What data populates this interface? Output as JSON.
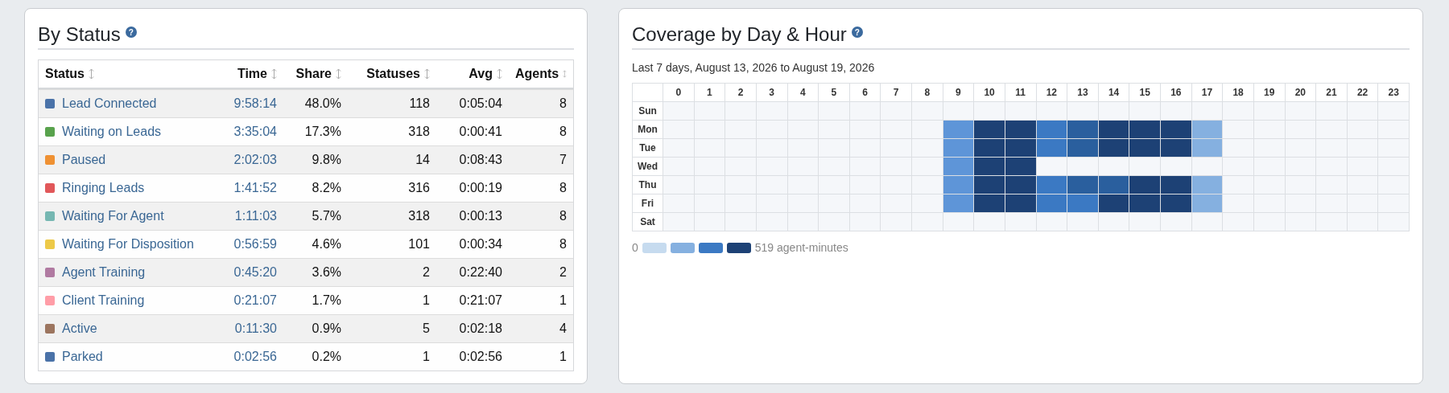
{
  "status_panel": {
    "title": "By Status",
    "help": "?",
    "columns": [
      "Status",
      "Time",
      "Share",
      "Statuses",
      "Avg",
      "Agents"
    ],
    "rows": [
      {
        "status": "Lead Connected",
        "color": "#4a72a8",
        "time": "9:58:14",
        "share": "48.0%",
        "statuses": "118",
        "avg": "0:05:04",
        "agents": "8"
      },
      {
        "status": "Waiting on Leads",
        "color": "#58a24c",
        "time": "3:35:04",
        "share": "17.3%",
        "statuses": "318",
        "avg": "0:00:41",
        "agents": "8"
      },
      {
        "status": "Paused",
        "color": "#ef9133",
        "time": "2:02:03",
        "share": "9.8%",
        "statuses": "14",
        "avg": "0:08:43",
        "agents": "7"
      },
      {
        "status": "Ringing Leads",
        "color": "#e15759",
        "time": "1:41:52",
        "share": "8.2%",
        "statuses": "316",
        "avg": "0:00:19",
        "agents": "8"
      },
      {
        "status": "Waiting For Agent",
        "color": "#76b7b2",
        "time": "1:11:03",
        "share": "5.7%",
        "statuses": "318",
        "avg": "0:00:13",
        "agents": "8"
      },
      {
        "status": "Waiting For Disposition",
        "color": "#edc948",
        "time": "0:56:59",
        "share": "4.6%",
        "statuses": "101",
        "avg": "0:00:34",
        "agents": "8"
      },
      {
        "status": "Agent Training",
        "color": "#b07aa1",
        "time": "0:45:20",
        "share": "3.6%",
        "statuses": "2",
        "avg": "0:22:40",
        "agents": "2"
      },
      {
        "status": "Client Training",
        "color": "#ff9da7",
        "time": "0:21:07",
        "share": "1.7%",
        "statuses": "1",
        "avg": "0:21:07",
        "agents": "1"
      },
      {
        "status": "Active",
        "color": "#9c755f",
        "time": "0:11:30",
        "share": "0.9%",
        "statuses": "5",
        "avg": "0:02:18",
        "agents": "4"
      },
      {
        "status": "Parked",
        "color": "#4a72a8",
        "time": "0:02:56",
        "share": "0.2%",
        "statuses": "1",
        "avg": "0:02:56",
        "agents": "1"
      }
    ]
  },
  "coverage_panel": {
    "title": "Coverage by Day & Hour",
    "help": "?",
    "subtitle": "Last 7 days, August 13, 2026 to August 19, 2026",
    "hours": [
      "0",
      "1",
      "2",
      "3",
      "4",
      "5",
      "6",
      "7",
      "8",
      "9",
      "10",
      "11",
      "12",
      "13",
      "14",
      "15",
      "16",
      "17",
      "18",
      "19",
      "20",
      "21",
      "22",
      "23"
    ],
    "days": [
      {
        "day": "Sun",
        "cells": [
          {
            "color": "#f5f7fa"
          },
          {
            "color": "#f5f7fa"
          },
          {
            "color": "#f5f7fa"
          },
          {
            "color": "#f5f7fa"
          },
          {
            "color": "#f5f7fa"
          },
          {
            "color": "#f5f7fa"
          },
          {
            "color": "#f5f7fa"
          },
          {
            "color": "#f5f7fa"
          },
          {
            "color": "#f5f7fa"
          },
          {
            "color": "#f5f7fa"
          },
          {
            "color": "#f5f7fa"
          },
          {
            "color": "#f5f7fa"
          },
          {
            "color": "#f5f7fa"
          },
          {
            "color": "#f5f7fa"
          },
          {
            "color": "#f5f7fa"
          },
          {
            "color": "#f5f7fa"
          },
          {
            "color": "#f5f7fa"
          },
          {
            "color": "#f5f7fa"
          },
          {
            "color": "#f5f7fa"
          },
          {
            "color": "#f5f7fa"
          },
          {
            "color": "#f5f7fa"
          },
          {
            "color": "#f5f7fa"
          },
          {
            "color": "#f5f7fa"
          },
          {
            "color": "#f5f7fa"
          }
        ]
      },
      {
        "day": "Mon",
        "cells": [
          {
            "color": "#f5f7fa"
          },
          {
            "color": "#f5f7fa"
          },
          {
            "color": "#f5f7fa"
          },
          {
            "color": "#f5f7fa"
          },
          {
            "color": "#f5f7fa"
          },
          {
            "color": "#f5f7fa"
          },
          {
            "color": "#f5f7fa"
          },
          {
            "color": "#f5f7fa"
          },
          {
            "color": "#f5f7fa"
          },
          {
            "color": "#5e95d8"
          },
          {
            "color": "#1d4175"
          },
          {
            "color": "#1d4175"
          },
          {
            "color": "#3b79c3"
          },
          {
            "color": "#2a5f9e"
          },
          {
            "color": "#1d4175"
          },
          {
            "color": "#1d4175"
          },
          {
            "color": "#1d4175"
          },
          {
            "color": "#85b0e0"
          },
          {
            "color": "#f5f7fa"
          },
          {
            "color": "#f5f7fa"
          },
          {
            "color": "#f5f7fa"
          },
          {
            "color": "#f5f7fa"
          },
          {
            "color": "#f5f7fa"
          },
          {
            "color": "#f5f7fa"
          }
        ]
      },
      {
        "day": "Tue",
        "cells": [
          {
            "color": "#f5f7fa"
          },
          {
            "color": "#f5f7fa"
          },
          {
            "color": "#f5f7fa"
          },
          {
            "color": "#f5f7fa"
          },
          {
            "color": "#f5f7fa"
          },
          {
            "color": "#f5f7fa"
          },
          {
            "color": "#f5f7fa"
          },
          {
            "color": "#f5f7fa"
          },
          {
            "color": "#f5f7fa"
          },
          {
            "color": "#5e95d8"
          },
          {
            "color": "#1d4175"
          },
          {
            "color": "#1d4175"
          },
          {
            "color": "#3b79c3"
          },
          {
            "color": "#2a5f9e"
          },
          {
            "color": "#1d4175"
          },
          {
            "color": "#1d4175"
          },
          {
            "color": "#1d4175"
          },
          {
            "color": "#85b0e0"
          },
          {
            "color": "#f5f7fa"
          },
          {
            "color": "#f5f7fa"
          },
          {
            "color": "#f5f7fa"
          },
          {
            "color": "#f5f7fa"
          },
          {
            "color": "#f5f7fa"
          },
          {
            "color": "#f5f7fa"
          }
        ]
      },
      {
        "day": "Wed",
        "cells": [
          {
            "color": "#f5f7fa"
          },
          {
            "color": "#f5f7fa"
          },
          {
            "color": "#f5f7fa"
          },
          {
            "color": "#f5f7fa"
          },
          {
            "color": "#f5f7fa"
          },
          {
            "color": "#f5f7fa"
          },
          {
            "color": "#f5f7fa"
          },
          {
            "color": "#f5f7fa"
          },
          {
            "color": "#f5f7fa"
          },
          {
            "color": "#5e95d8"
          },
          {
            "color": "#1d4175"
          },
          {
            "color": "#1d4175"
          },
          {
            "color": "#f5f7fa"
          },
          {
            "color": "#f5f7fa"
          },
          {
            "color": "#f5f7fa"
          },
          {
            "color": "#f5f7fa"
          },
          {
            "color": "#f5f7fa"
          },
          {
            "color": "#f5f7fa"
          },
          {
            "color": "#f5f7fa"
          },
          {
            "color": "#f5f7fa"
          },
          {
            "color": "#f5f7fa"
          },
          {
            "color": "#f5f7fa"
          },
          {
            "color": "#f5f7fa"
          },
          {
            "color": "#f5f7fa"
          }
        ]
      },
      {
        "day": "Thu",
        "cells": [
          {
            "color": "#f5f7fa"
          },
          {
            "color": "#f5f7fa"
          },
          {
            "color": "#f5f7fa"
          },
          {
            "color": "#f5f7fa"
          },
          {
            "color": "#f5f7fa"
          },
          {
            "color": "#f5f7fa"
          },
          {
            "color": "#f5f7fa"
          },
          {
            "color": "#f5f7fa"
          },
          {
            "color": "#f5f7fa"
          },
          {
            "color": "#5e95d8"
          },
          {
            "color": "#1d4175"
          },
          {
            "color": "#1d4175"
          },
          {
            "color": "#3b79c3"
          },
          {
            "color": "#2a5f9e"
          },
          {
            "color": "#2a5f9e"
          },
          {
            "color": "#1d4175"
          },
          {
            "color": "#1d4175"
          },
          {
            "color": "#85b0e0"
          },
          {
            "color": "#f5f7fa"
          },
          {
            "color": "#f5f7fa"
          },
          {
            "color": "#f5f7fa"
          },
          {
            "color": "#f5f7fa"
          },
          {
            "color": "#f5f7fa"
          },
          {
            "color": "#f5f7fa"
          }
        ]
      },
      {
        "day": "Fri",
        "cells": [
          {
            "color": "#f5f7fa"
          },
          {
            "color": "#f5f7fa"
          },
          {
            "color": "#f5f7fa"
          },
          {
            "color": "#f5f7fa"
          },
          {
            "color": "#f5f7fa"
          },
          {
            "color": "#f5f7fa"
          },
          {
            "color": "#f5f7fa"
          },
          {
            "color": "#f5f7fa"
          },
          {
            "color": "#f5f7fa"
          },
          {
            "color": "#5e95d8"
          },
          {
            "color": "#1d4175"
          },
          {
            "color": "#1d4175"
          },
          {
            "color": "#3b79c3"
          },
          {
            "color": "#3b79c3"
          },
          {
            "color": "#1d4175"
          },
          {
            "color": "#1d4175"
          },
          {
            "color": "#1d4175"
          },
          {
            "color": "#85b0e0"
          },
          {
            "color": "#f5f7fa"
          },
          {
            "color": "#f5f7fa"
          },
          {
            "color": "#f5f7fa"
          },
          {
            "color": "#f5f7fa"
          },
          {
            "color": "#f5f7fa"
          },
          {
            "color": "#f5f7fa"
          }
        ]
      },
      {
        "day": "Sat",
        "cells": [
          {
            "color": "#f5f7fa"
          },
          {
            "color": "#f5f7fa"
          },
          {
            "color": "#f5f7fa"
          },
          {
            "color": "#f5f7fa"
          },
          {
            "color": "#f5f7fa"
          },
          {
            "color": "#f5f7fa"
          },
          {
            "color": "#f5f7fa"
          },
          {
            "color": "#f5f7fa"
          },
          {
            "color": "#f5f7fa"
          },
          {
            "color": "#f5f7fa"
          },
          {
            "color": "#f5f7fa"
          },
          {
            "color": "#f5f7fa"
          },
          {
            "color": "#f5f7fa"
          },
          {
            "color": "#f5f7fa"
          },
          {
            "color": "#f5f7fa"
          },
          {
            "color": "#f5f7fa"
          },
          {
            "color": "#f5f7fa"
          },
          {
            "color": "#f5f7fa"
          },
          {
            "color": "#f5f7fa"
          },
          {
            "color": "#f5f7fa"
          },
          {
            "color": "#f5f7fa"
          },
          {
            "color": "#f5f7fa"
          },
          {
            "color": "#f5f7fa"
          },
          {
            "color": "#f5f7fa"
          }
        ]
      }
    ],
    "legend": {
      "min": "0",
      "max": "519 agent-minutes",
      "swatches": [
        {
          "color": "#c6dbef"
        },
        {
          "color": "#85b0e0"
        },
        {
          "color": "#3b79c3"
        },
        {
          "color": "#1d4175"
        }
      ]
    }
  }
}
